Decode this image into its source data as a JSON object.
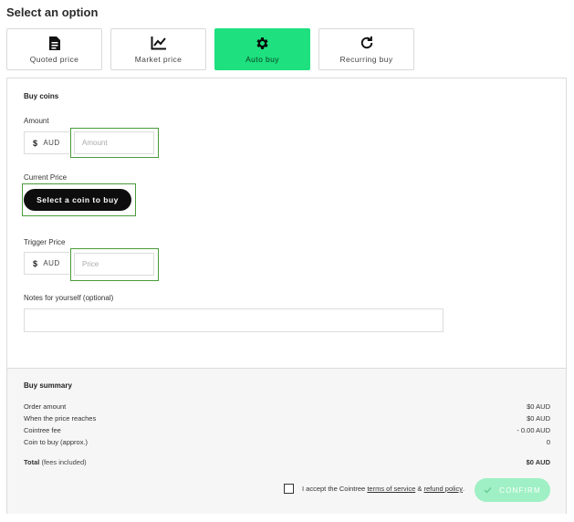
{
  "page": {
    "title": "Select an option"
  },
  "options": [
    {
      "label": "Quoted price",
      "icon": "document-icon",
      "active": false
    },
    {
      "label": "Market price",
      "icon": "chart-line-icon",
      "active": false
    },
    {
      "label": "Auto buy",
      "icon": "gear-icon",
      "active": true
    },
    {
      "label": "Recurring buy",
      "icon": "refresh-icon",
      "active": false
    }
  ],
  "form": {
    "section_title": "Buy coins",
    "amount_label": "Amount",
    "currency_symbol": "$",
    "currency_code": "AUD",
    "amount_placeholder": "Amount",
    "current_price_label": "Current Price",
    "select_coin_label": "Select a coin to buy",
    "trigger_price_label": "Trigger Price",
    "price_placeholder": "Price",
    "notes_label": "Notes for yourself (optional)"
  },
  "summary": {
    "title": "Buy summary",
    "rows": [
      {
        "label": "Order amount",
        "value": "$0 AUD"
      },
      {
        "label": "When the price reaches",
        "value": "$0 AUD"
      },
      {
        "label": "Cointree fee",
        "value": "- 0.00 AUD"
      },
      {
        "label": "Coin to buy (approx.)",
        "value": "0"
      }
    ],
    "total_label": "Total",
    "total_note": "(fees included)",
    "total_value": "$0 AUD"
  },
  "accept": {
    "prefix": "I accept the Cointree",
    "terms_link": "terms of service",
    "amp": "&",
    "refund_link": "refund policy",
    "suffix": "."
  },
  "confirm_label": "CONFIRM",
  "colors": {
    "accent": "#1ee07f",
    "confirm_disabled": "#9ff0c4",
    "outline": "#4a9a3c"
  }
}
